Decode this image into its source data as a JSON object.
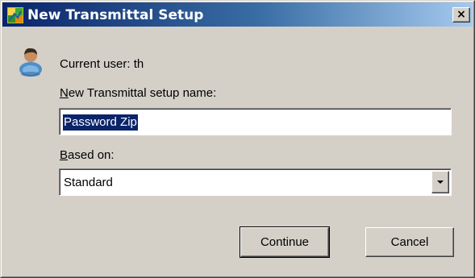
{
  "window": {
    "title": "New Transmittal Setup",
    "close_label": "×"
  },
  "form": {
    "current_user_label": "Current user: th",
    "name_label": "New Transmittal setup name:",
    "name_label_access_key": "N",
    "name_value": "Password Zip",
    "based_on_label": "Based on:",
    "based_on_access_key": "B",
    "based_on_value": "Standard"
  },
  "buttons": {
    "continue_label": "Continue",
    "cancel_label": "Cancel"
  },
  "colors": {
    "titlebar_start": "#0a246a",
    "titlebar_end": "#a6caf0",
    "face": "#d4d0c8",
    "selection": "#0a246a"
  },
  "icons": {
    "app": "transmittal-app-icon",
    "user": "user-person-icon",
    "close": "close-icon",
    "dropdown": "chevron-down-icon"
  }
}
